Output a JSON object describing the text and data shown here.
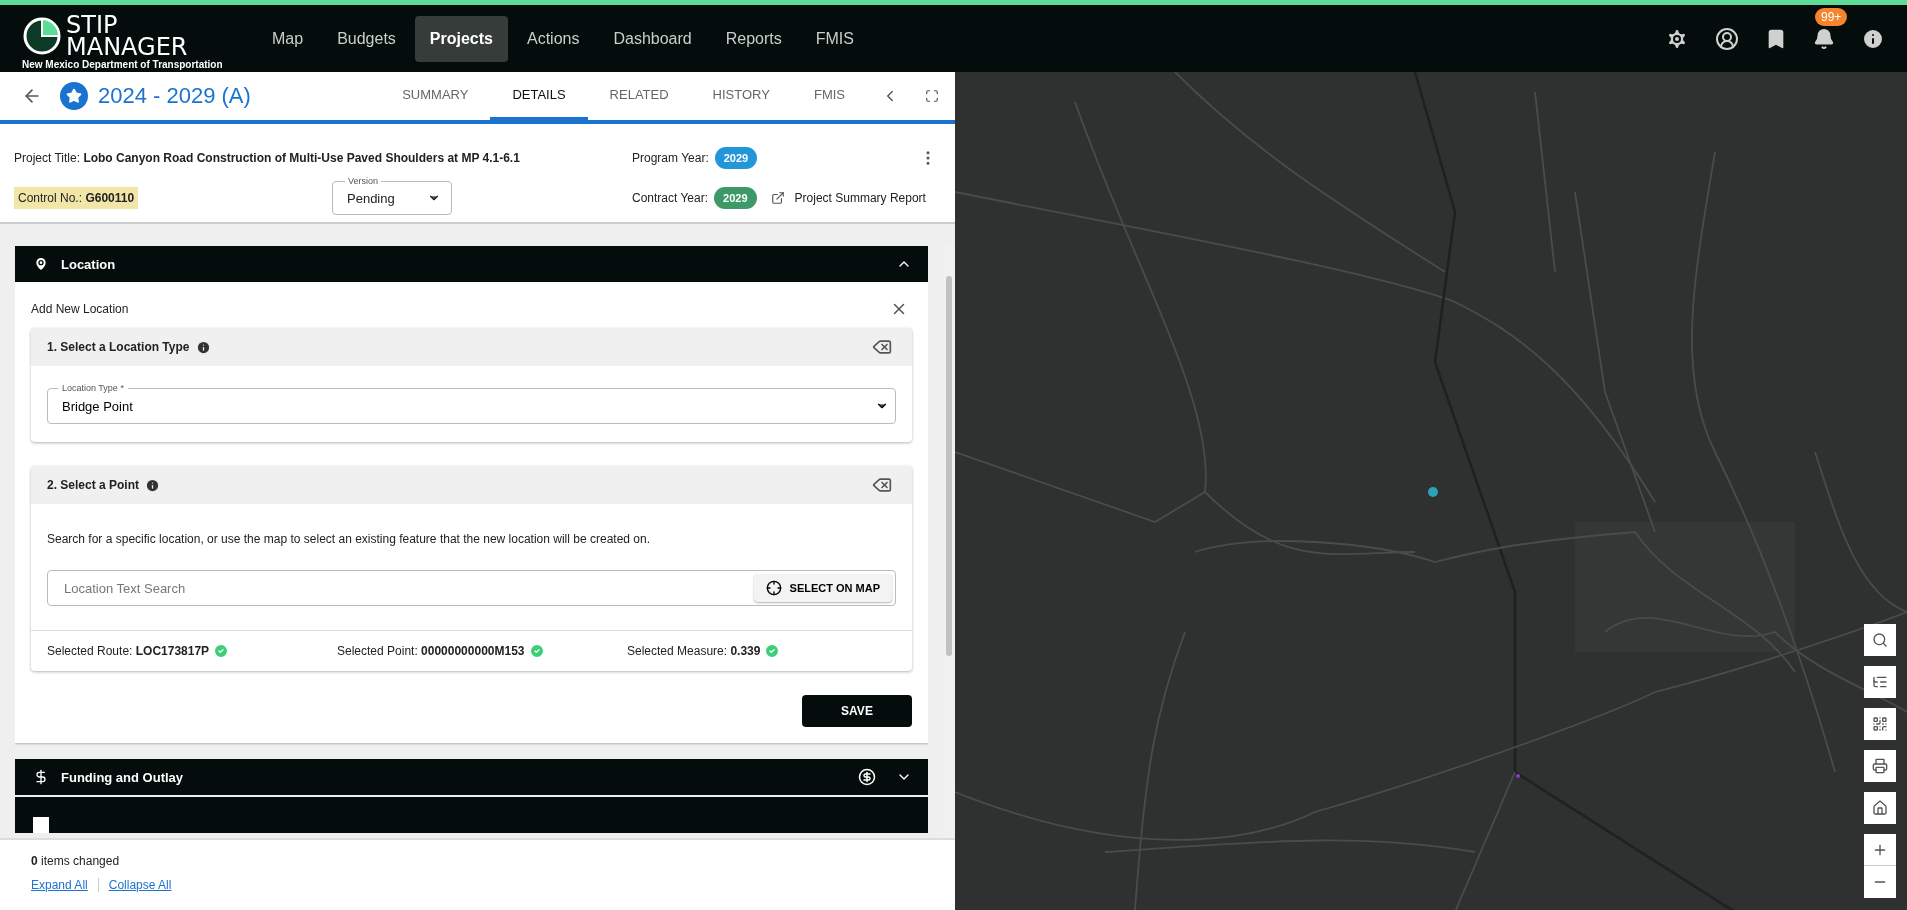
{
  "app": {
    "logo_title_1": "STIP",
    "logo_title_2": "MANAGER",
    "logo_subtitle": "New Mexico Department of Transportation"
  },
  "nav": [
    {
      "label": "Map",
      "selected": false
    },
    {
      "label": "Budgets",
      "selected": false
    },
    {
      "label": "Projects",
      "selected": true
    },
    {
      "label": "Actions",
      "selected": false
    },
    {
      "label": "Dashboard",
      "selected": false
    },
    {
      "label": "Reports",
      "selected": false
    },
    {
      "label": "FMIS",
      "selected": false
    }
  ],
  "notifications": {
    "badge": "99+"
  },
  "project": {
    "title": "2024 - 2029 (A)",
    "favorite": true
  },
  "tabs": [
    {
      "label": "SUMMARY",
      "selected": false
    },
    {
      "label": "DETAILS",
      "selected": true
    },
    {
      "label": "RELATED",
      "selected": false
    },
    {
      "label": "HISTORY",
      "selected": false
    },
    {
      "label": "FMIS",
      "selected": false
    }
  ],
  "info": {
    "title_label": "Project Title:",
    "title_value": "Lobo Canyon Road Construction of Multi-Use Paved Shoulders at MP 4.1-6.1",
    "control_label": "Control No.:",
    "control_value": "G600110",
    "version_label": "Version",
    "version_value": "Pending",
    "program_year_label": "Program Year:",
    "program_year": "2029",
    "contract_year_label": "Contract Year:",
    "contract_year": "2029",
    "report_link": "Project Summary Report"
  },
  "location": {
    "header": "Location",
    "expanded": true,
    "form_title": "Add New Location",
    "step1": {
      "title": "1. Select a Location Type",
      "field_label": "Location Type *",
      "field_value": "Bridge Point"
    },
    "step2": {
      "title": "2. Select a Point",
      "hint": "Search for a specific location, or use the map to select an existing feature that the new location will be created on.",
      "search_placeholder": "Location Text Search",
      "select_button": "SELECT ON MAP",
      "results": [
        {
          "label": "Selected Route:",
          "value": "LOC173817P",
          "ok": true
        },
        {
          "label": "Selected Point:",
          "value": "00000000000M153",
          "ok": true
        },
        {
          "label": "Selected Measure:",
          "value": "0.339",
          "ok": true
        }
      ]
    },
    "save": "SAVE"
  },
  "funding": {
    "header": "Funding and Outlay",
    "expanded": false
  },
  "footer": {
    "count": "0",
    "count_text": "items changed",
    "expand_all": "Expand All",
    "collapse_all": "Collapse All"
  }
}
